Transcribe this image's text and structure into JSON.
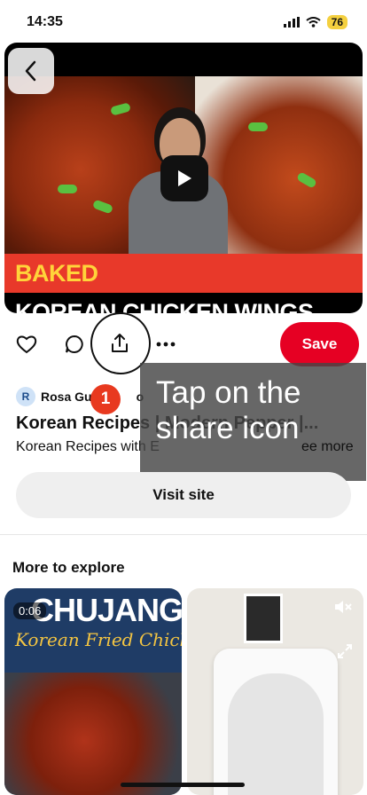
{
  "status_bar": {
    "time": "14:35",
    "battery": "76"
  },
  "video": {
    "banner_part1": "BAKED",
    "banner_part2": " KOREAN CHICKEN WINGS"
  },
  "actions": {
    "save_label": "Save"
  },
  "pin": {
    "creator_initial": "R",
    "creator_name": "Rosa Gu",
    "creator_name_tail": "o",
    "title": "Korean Recipes | Modern Pepper |...",
    "description": "Korean Recipes with E",
    "description_tail": "ee more"
  },
  "annotation": {
    "step": "1",
    "tooltip": "Tap on the share icon"
  },
  "visit_site_label": "Visit site",
  "explore": {
    "title": "More to explore",
    "card1": {
      "duration": "0:06",
      "brand": "CHUJANG",
      "subtitle": "Korean Fried Chicken"
    }
  },
  "colors": {
    "accent": "#e60023",
    "badge": "#e8391f"
  }
}
